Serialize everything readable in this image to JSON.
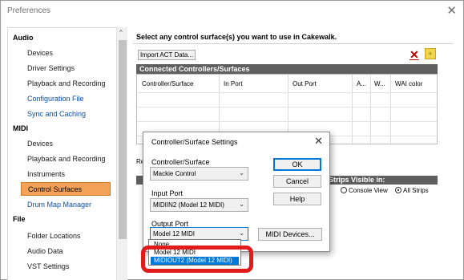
{
  "window": {
    "title": "Preferences",
    "close_glyph": "✕"
  },
  "sidebar": {
    "scroll_arrow": "^",
    "groups": [
      {
        "label": "Audio"
      },
      {
        "label": "MIDI"
      },
      {
        "label": "File"
      }
    ],
    "audio_items": [
      "Devices",
      "Driver Settings",
      "Playback and Recording",
      "Configuration File",
      "Sync and Caching"
    ],
    "midi_items": [
      "Devices",
      "Playback and Recording",
      "Instruments",
      "Control Surfaces",
      "Drum Map Manager"
    ],
    "file_items": [
      "Folder Locations",
      "Audio Data",
      "VST Settings"
    ],
    "selected": "Control Surfaces"
  },
  "main": {
    "heading": "Select any control surface(s) you want to use in Cakewalk.",
    "import_button": "Import ACT Data...",
    "delete_icon": "✕",
    "add_icon": "+",
    "section_title": "Connected Controllers/Surfaces",
    "columns": [
      "Controller/Surface",
      "In Port",
      "Out Port",
      "A...",
      "W...",
      "WAI color"
    ],
    "partial_label": "Re",
    "strips_title": "Strips Visible in:",
    "radio_console": "Console View",
    "radio_all": "All Strips",
    "radio_selected": "All Strips"
  },
  "dialog": {
    "title": "Controller/Surface Settings",
    "close_glyph": "✕",
    "controller_label": "Controller/Surface",
    "controller_value": "Mackie Control",
    "input_label": "Input Port",
    "input_value": "MIDIIN2 (Model 12 MIDI)",
    "output_label": "Output Port",
    "output_value": "Model 12 MIDI",
    "ok_button": "OK",
    "cancel_button": "Cancel",
    "help_button": "Help",
    "midi_devices_button": "MIDI Devices...",
    "chevron": "⌄"
  },
  "dropdown": {
    "options": [
      "None",
      "Model 12 MIDI",
      "MIDIOUT2 (Model 12 MIDI)"
    ],
    "highlighted": "MIDIOUT2 (Model 12 MIDI)"
  },
  "colors": {
    "selected_item_bg": "#f4a257",
    "section_bar": "#5f5f5f",
    "link_blue": "#0b4fa8",
    "dropdown_highlight": "#0078d7",
    "annotation_red": "#e11a1a"
  }
}
